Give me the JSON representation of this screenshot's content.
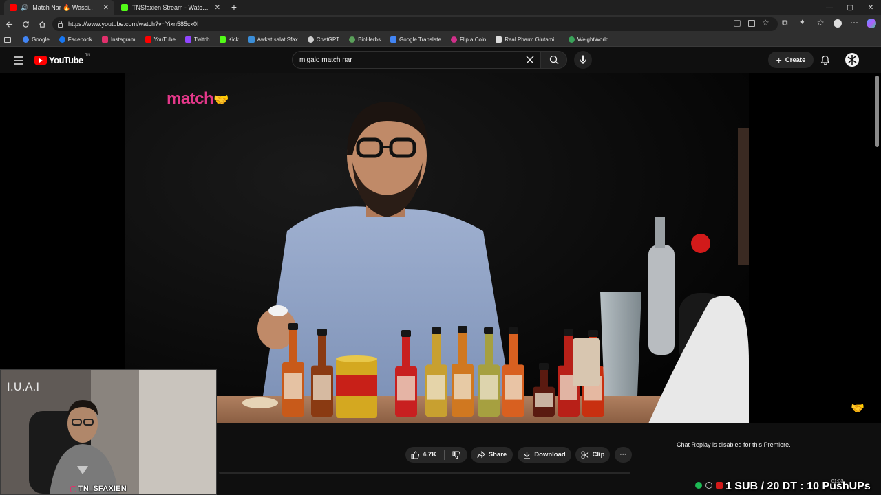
{
  "browser": {
    "tabs": [
      {
        "title": "Match Nar 🔥 Wassim Migalo",
        "favicon_color": "#ff0000",
        "active": true
      },
      {
        "title": "TNSfaxien Stream - Watch Live on Kick",
        "favicon_color": "#53fc18",
        "active": false
      }
    ],
    "new_tab_label": "+",
    "url": "https://www.youtube.com/watch?v=Yixn585ck0I",
    "window_controls": {
      "minimize": "—",
      "maximize": "▢",
      "close": "✕"
    }
  },
  "bookmarks": [
    {
      "label": "Google",
      "color": "#4285f4"
    },
    {
      "label": "Facebook",
      "color": "#1877f2"
    },
    {
      "label": "Instagram",
      "color": "#e1306c"
    },
    {
      "label": "YouTube",
      "color": "#ff0000"
    },
    {
      "label": "Twitch",
      "color": "#9146ff"
    },
    {
      "label": "Kick",
      "color": "#53fc18"
    },
    {
      "label": "Awkat salat Sfax",
      "color": "#3b8ed8"
    },
    {
      "label": "ChatGPT",
      "color": "#cfcfcf"
    },
    {
      "label": "BioHerbs",
      "color": "#5aa05a"
    },
    {
      "label": "Google Translate",
      "color": "#4285f4"
    },
    {
      "label": "Flip a Coin",
      "color": "#d0308a"
    },
    {
      "label": "Real Pharm Glutami...",
      "color": "#dddddd"
    },
    {
      "label": "WeightWorld",
      "color": "#3aa35a"
    }
  ],
  "youtube": {
    "logo_text": "YouTube",
    "country_code": "TN",
    "search_value": "migalo match nar",
    "create_label": "Create"
  },
  "video": {
    "brand_text": "match",
    "bottles": [
      {
        "color": "#c85a1a"
      },
      {
        "color": "#8a3a12"
      },
      {
        "color": "#c82020"
      },
      {
        "color": "#c8a030"
      },
      {
        "color": "#d07820"
      },
      {
        "color": "#a6a040"
      },
      {
        "color": "#d86020"
      },
      {
        "color": "#5a1a10"
      },
      {
        "color": "#b82018"
      },
      {
        "color": "#c83010"
      }
    ]
  },
  "webcam": {
    "handle": "TN_SFAXIEN"
  },
  "actions": {
    "likes": "4.7K",
    "share": "Share",
    "download": "Download",
    "clip": "Clip",
    "more": "···"
  },
  "chat": {
    "replay_message": "Chat Replay is disabled for this Premiere."
  },
  "stream_overlay": {
    "goal_text": "1 SUB / 20 DT : 10 PushUPs",
    "clock": "01:33"
  },
  "colors": {
    "brand_pink": "#e4388a",
    "youtube_red": "#ff0000",
    "background": "#0f0f0f"
  }
}
